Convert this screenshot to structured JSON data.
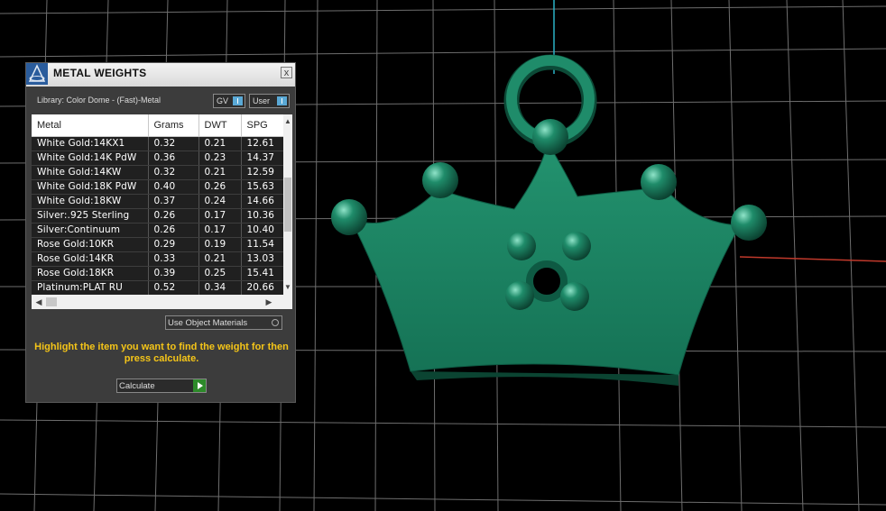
{
  "panel": {
    "title": "METAL WEIGHTS",
    "close_label": "x",
    "library": "Library: Color Dome - (Fast)-Metal",
    "gv_toggle": "GV",
    "user_toggle": "User",
    "columns": [
      "Metal",
      "Grams",
      "DWT",
      "SPG"
    ],
    "rows": [
      [
        "White Gold:14KX1",
        "0.32",
        "0.21",
        "12.61"
      ],
      [
        "White Gold:14K PdW",
        "0.36",
        "0.23",
        "14.37"
      ],
      [
        "White Gold:14KW",
        "0.32",
        "0.21",
        "12.59"
      ],
      [
        "White Gold:18K PdW",
        "0.40",
        "0.26",
        "15.63"
      ],
      [
        "White Gold:18KW",
        "0.37",
        "0.24",
        "14.66"
      ],
      [
        "Silver:.925 Sterling",
        "0.26",
        "0.17",
        "10.36"
      ],
      [
        "Silver:Continuum",
        "0.26",
        "0.17",
        "10.40"
      ],
      [
        "Rose Gold:10KR",
        "0.29",
        "0.19",
        "11.54"
      ],
      [
        "Rose Gold:14KR",
        "0.33",
        "0.21",
        "13.03"
      ],
      [
        "Rose Gold:18KR",
        "0.39",
        "0.25",
        "15.41"
      ],
      [
        "Platinum:PLAT RU",
        "0.52",
        "0.34",
        "20.66"
      ]
    ],
    "use_object_materials": "Use Object Materials",
    "instruction": "Highlight the item you want to find the weight for then press calculate.",
    "calculate_label": "Calculate"
  },
  "colors": {
    "background": "#000000",
    "grid": "#6e6e6e",
    "crown": "#1d8061",
    "instruction_text": "#f5c518",
    "toggle_accent": "#5aa9d6",
    "play_button": "#2d8a2a",
    "axis_red": "#c0392b",
    "axis_cyan": "#2bb3c7"
  }
}
